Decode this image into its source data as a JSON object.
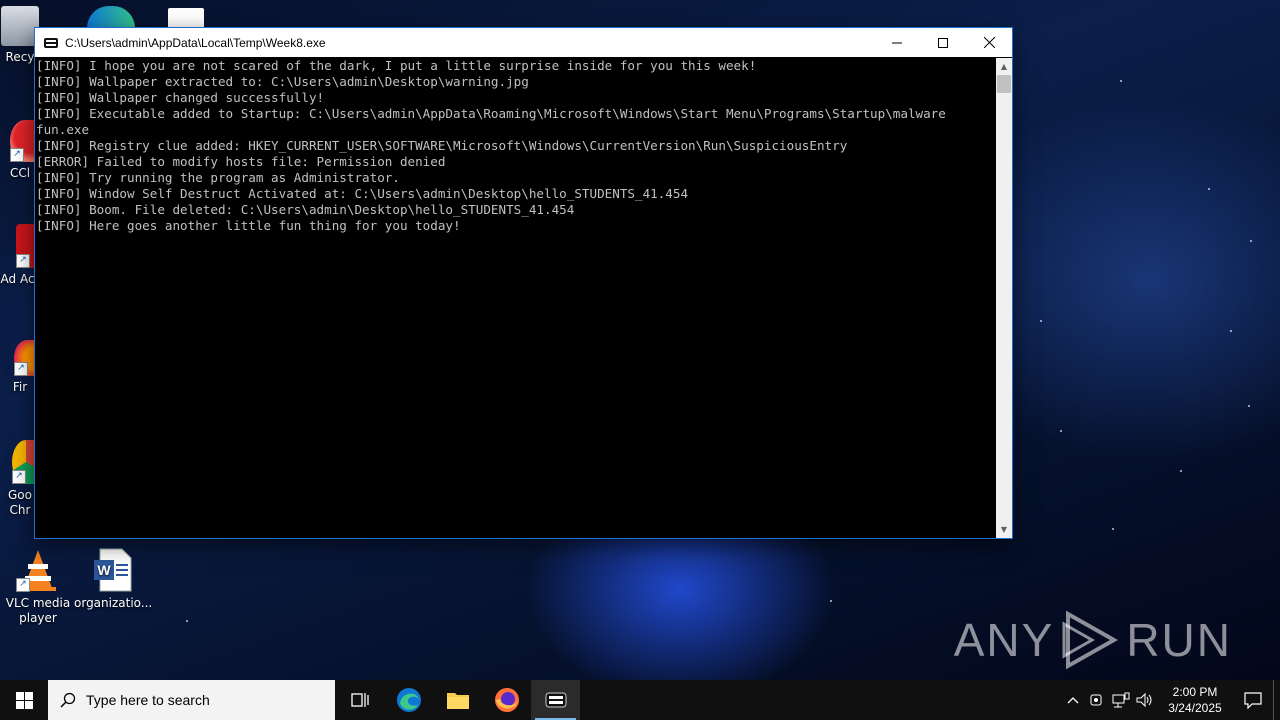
{
  "desktop": {
    "icons": [
      {
        "name": "recycle-bin",
        "label": "Recy"
      },
      {
        "name": "ccleaner",
        "label": "CCl"
      },
      {
        "name": "adobe-acrobat",
        "label": "Ad Acr"
      },
      {
        "name": "firefox",
        "label": "Fir"
      },
      {
        "name": "google-chrome",
        "label": "Goo Chr"
      },
      {
        "name": "vlc",
        "label": "VLC media player"
      },
      {
        "name": "word-doc",
        "label": "organizatio..."
      }
    ]
  },
  "window": {
    "title": "C:\\Users\\admin\\AppData\\Local\\Temp\\Week8.exe",
    "lines": [
      "[INFO] I hope you are not scared of the dark, I put a little surprise inside for you this week!",
      "[INFO] Wallpaper extracted to: C:\\Users\\admin\\Desktop\\warning.jpg",
      "[INFO] Wallpaper changed successfully!",
      "[INFO] Executable added to Startup: C:\\Users\\admin\\AppData\\Roaming\\Microsoft\\Windows\\Start Menu\\Programs\\Startup\\malware",
      "fun.exe",
      "[INFO] Registry clue added: HKEY_CURRENT_USER\\SOFTWARE\\Microsoft\\Windows\\CurrentVersion\\Run\\SuspiciousEntry",
      "[ERROR] Failed to modify hosts file: Permission denied",
      "[INFO] Try running the program as Administrator.",
      "[INFO] Window Self Destruct Activated at: C:\\Users\\admin\\Desktop\\hello_STUDENTS_41.454",
      "[INFO] Boom. File deleted: C:\\Users\\admin\\Desktop\\hello_STUDENTS_41.454",
      "[INFO] Here goes another little fun thing for you today!"
    ]
  },
  "watermark": {
    "left": "ANY",
    "right": "RUN"
  },
  "taskbar": {
    "search_placeholder": "Type here to search",
    "time": "2:00 PM",
    "date": "3/24/2025"
  }
}
